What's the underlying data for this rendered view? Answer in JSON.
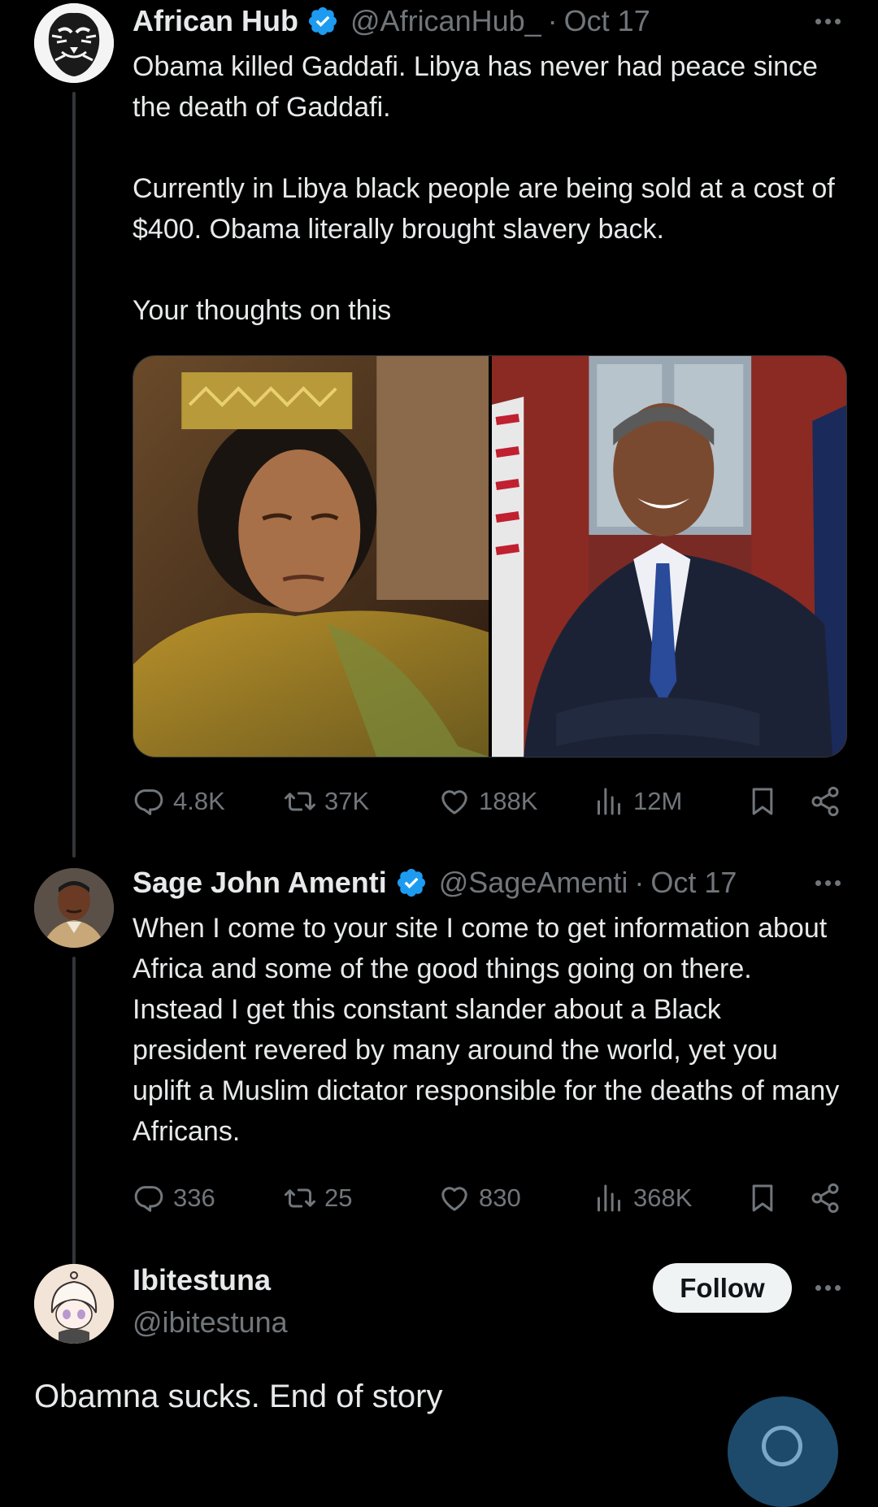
{
  "tweets": [
    {
      "name": "African Hub",
      "handle": "@AfricanHub_",
      "separator": "·",
      "date": "Oct 17",
      "text": "Obama killed Gaddafi. Libya has never had peace since the death of Gaddafi.\n\nCurrently in Libya black people are being sold at a cost of $400. Obama literally brought slavery back.\n\nYour thoughts on this",
      "replies": "4.8K",
      "reposts": "37K",
      "likes": "188K",
      "views": "12M"
    },
    {
      "name": "Sage John Amenti",
      "handle": "@SageAmenti",
      "separator": "·",
      "date": "Oct 17",
      "text": "When I come to your site I come to get information about Africa and some of the good things going on there. Instead I get this constant slander about a Black president revered by many around the world, yet you uplift a Muslim dictator responsible for the deaths of many Africans.",
      "replies": "336",
      "reposts": "25",
      "likes": "830",
      "views": "368K"
    }
  ],
  "reply": {
    "name": "Ibitestuna",
    "handle": "@ibitestuna",
    "follow_label": "Follow",
    "text": "Obamna sucks. End of story"
  },
  "colors": {
    "background": "#000000",
    "text": "#e7e9ea",
    "muted": "#71767b",
    "verified": "#1d9bf0",
    "follow_bg": "#eff3f4"
  },
  "icons": [
    "verified-badge-icon",
    "more-icon",
    "reply-icon",
    "repost-icon",
    "like-icon",
    "views-icon",
    "bookmark-icon",
    "share-icon",
    "compose-icon"
  ]
}
